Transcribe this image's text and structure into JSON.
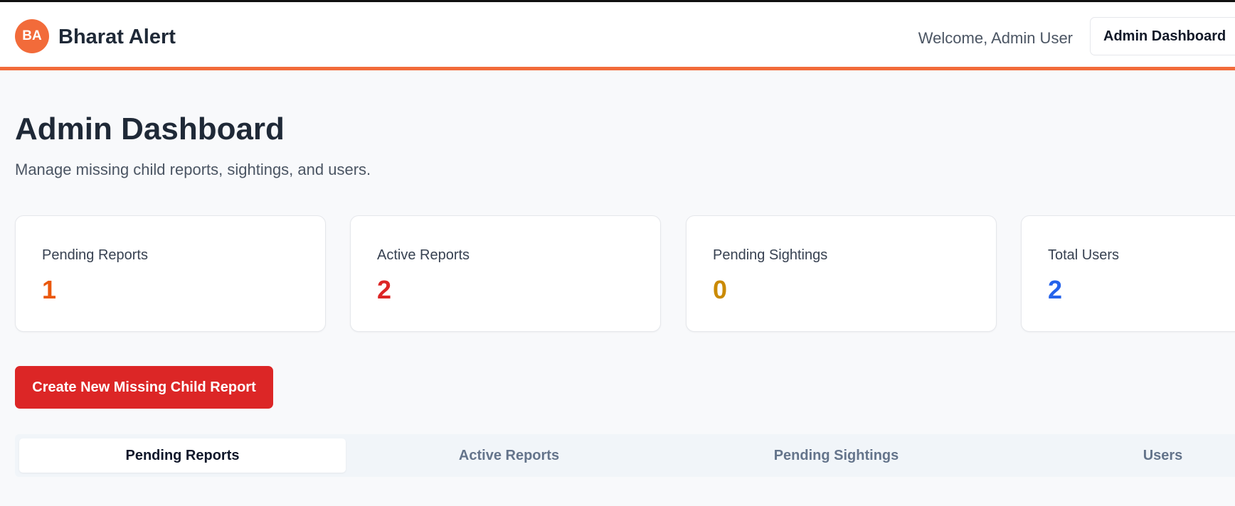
{
  "header": {
    "logo_initials": "BA",
    "brand": "Bharat Alert",
    "welcome": "Welcome, Admin User",
    "dashboard_button": "Admin Dashboard"
  },
  "page": {
    "title": "Admin Dashboard",
    "subtitle": "Manage missing child reports, sightings, and users."
  },
  "stats": [
    {
      "label": "Pending Reports",
      "value": "1",
      "color": "#ea580c"
    },
    {
      "label": "Active Reports",
      "value": "2",
      "color": "#dc2626"
    },
    {
      "label": "Pending Sightings",
      "value": "0",
      "color": "#ca8a04"
    },
    {
      "label": "Total Users",
      "value": "2",
      "color": "#2563eb"
    }
  ],
  "actions": {
    "create_report": "Create New Missing Child Report"
  },
  "tabs": [
    {
      "label": "Pending Reports",
      "active": true
    },
    {
      "label": "Active Reports",
      "active": false
    },
    {
      "label": "Pending Sightings",
      "active": false
    },
    {
      "label": "Users",
      "active": false
    }
  ],
  "colors": {
    "accent": "#f26b3a",
    "danger": "#dc2626"
  }
}
